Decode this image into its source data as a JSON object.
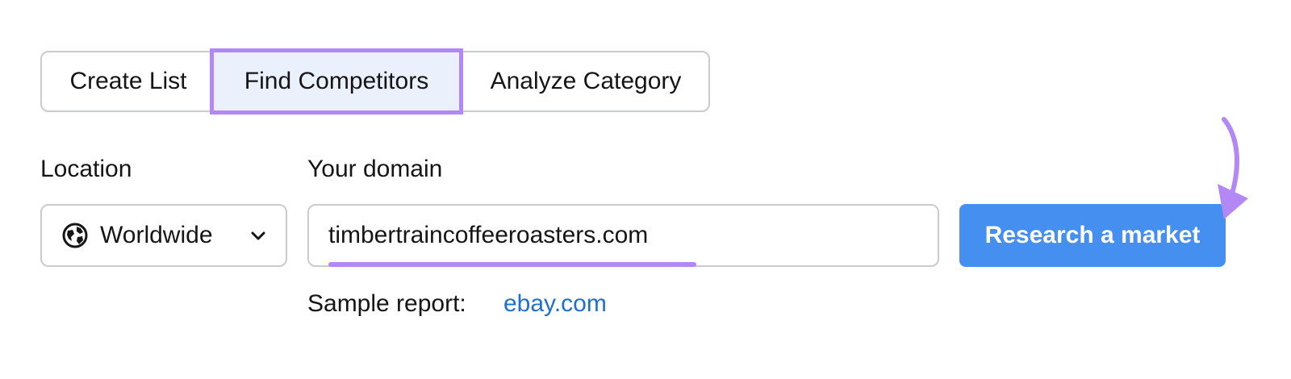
{
  "tabs": {
    "create_list": "Create List",
    "find_competitors": "Find Competitors",
    "analyze_category": "Analyze Category"
  },
  "location": {
    "label": "Location",
    "value": "Worldwide",
    "icon": "globe-icon"
  },
  "domain": {
    "label": "Your domain",
    "value": "timbertraincoffeeroasters.com"
  },
  "button": {
    "label": "Research a market"
  },
  "sample": {
    "label": "Sample report:",
    "link": "ebay.com"
  },
  "colors": {
    "highlight": "#b388f5",
    "selected_tab_bg": "#eaf1fd",
    "button_bg": "#448ff0",
    "link": "#1f6fd1"
  }
}
